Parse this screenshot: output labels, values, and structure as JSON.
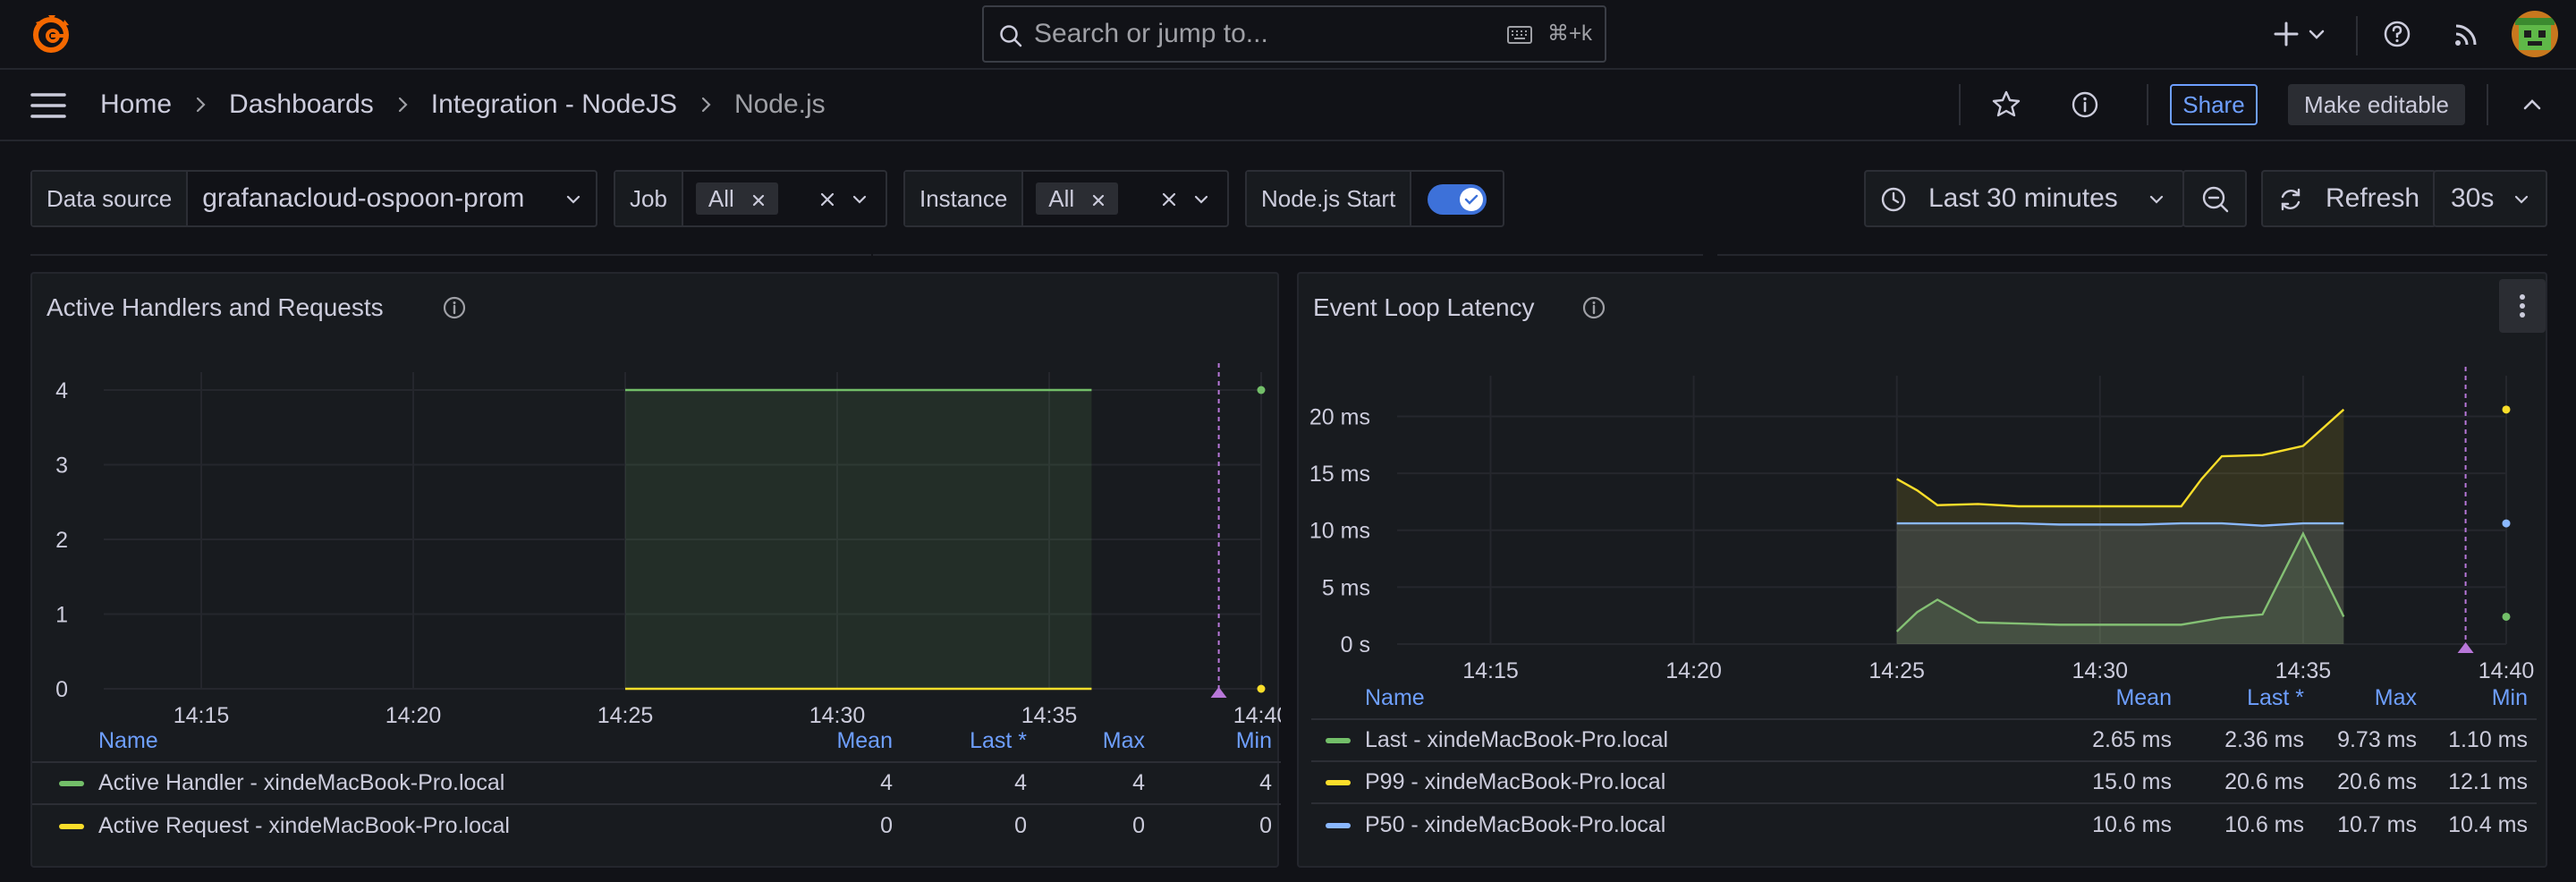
{
  "topbar": {
    "search_placeholder": "Search or jump to...",
    "search_shortcut": "⌘+k",
    "icons": [
      "grafana-logo-icon",
      "search-icon",
      "keyboard-icon",
      "plus-icon",
      "chevron-down-icon",
      "help-icon",
      "rss-icon",
      "user-avatar"
    ]
  },
  "breadcrumbs": [
    "Home",
    "Dashboards",
    "Integration - NodeJS",
    "Node.js"
  ],
  "navbar": {
    "share_label": "Share",
    "edit_label": "Make editable"
  },
  "variables": {
    "datasource": {
      "label": "Data source",
      "value": "grafanacloud-ospoon-prom"
    },
    "job": {
      "label": "Job",
      "value": "All"
    },
    "instance": {
      "label": "Instance",
      "value": "All"
    },
    "nodejs_start": {
      "label": "Node.js Start",
      "enabled": true
    }
  },
  "time": {
    "range_label": "Last 30 minutes",
    "refresh_label": "Refresh",
    "interval": "30s"
  },
  "colors": {
    "green": "#73bf69",
    "yellow": "#fade2a",
    "blue": "#8ab8ff",
    "accent": "#6e9fff",
    "purple": "#b877d9"
  },
  "panels": [
    {
      "title": "Active Handlers and Requests",
      "legend": {
        "headers": [
          "Name",
          "Mean",
          "Last *",
          "Max",
          "Min"
        ],
        "rows": [
          {
            "name": "Active Handler - xindeMacBook-Pro.local",
            "color": "#73bf69",
            "values": [
              "4",
              "4",
              "4",
              "4"
            ]
          },
          {
            "name": "Active Request - xindeMacBook-Pro.local",
            "color": "#fade2a",
            "values": [
              "0",
              "0",
              "0",
              "0"
            ]
          }
        ]
      }
    },
    {
      "title": "Event Loop Latency",
      "legend": {
        "headers": [
          "Name",
          "Mean",
          "Last *",
          "Max",
          "Min"
        ],
        "rows": [
          {
            "name": "Last - xindeMacBook-Pro.local",
            "color": "#73bf69",
            "values": [
              "2.65 ms",
              "2.36 ms",
              "9.73 ms",
              "1.10 ms"
            ]
          },
          {
            "name": "P99 - xindeMacBook-Pro.local",
            "color": "#fade2a",
            "values": [
              "15.0 ms",
              "20.6 ms",
              "20.6 ms",
              "12.1 ms"
            ]
          },
          {
            "name": "P50 - xindeMacBook-Pro.local",
            "color": "#8ab8ff",
            "values": [
              "10.6 ms",
              "10.6 ms",
              "10.7 ms",
              "10.4 ms"
            ]
          }
        ]
      }
    }
  ],
  "chart_data": [
    {
      "type": "line",
      "title": "Active Handlers and Requests",
      "x_ticks": [
        "14:15",
        "14:20",
        "14:25",
        "14:30",
        "14:35",
        "14:40"
      ],
      "y_ticks": [
        "0",
        "1",
        "2",
        "3",
        "4"
      ],
      "ylim": [
        0,
        4
      ],
      "x": [
        "14:25",
        "14:36"
      ],
      "series": [
        {
          "name": "Active Handler - xindeMacBook-Pro.local",
          "values": [
            4,
            4
          ],
          "color": "#73bf69"
        },
        {
          "name": "Active Request - xindeMacBook-Pro.local",
          "values": [
            0,
            0
          ],
          "color": "#fade2a"
        }
      ],
      "annotation": "14:39"
    },
    {
      "type": "line",
      "title": "Event Loop Latency",
      "x_ticks": [
        "14:15",
        "14:20",
        "14:25",
        "14:30",
        "14:35",
        "14:40"
      ],
      "y_ticks": [
        "0 s",
        "5 ms",
        "10 ms",
        "15 ms",
        "20 ms"
      ],
      "ylim": [
        0,
        22
      ],
      "x": [
        "14:25",
        "14:25:30",
        "14:26",
        "14:27",
        "14:28",
        "14:29",
        "14:30",
        "14:31",
        "14:32",
        "14:32:30",
        "14:33",
        "14:34",
        "14:35",
        "14:36"
      ],
      "series": [
        {
          "name": "Last - xindeMacBook-Pro.local",
          "color": "#73bf69",
          "values": [
            1.1,
            2.8,
            3.9,
            1.9,
            1.8,
            1.7,
            1.7,
            1.7,
            1.7,
            2.0,
            2.3,
            2.6,
            9.7,
            2.4
          ]
        },
        {
          "name": "P99 - xindeMacBook-Pro.local",
          "color": "#fade2a",
          "values": [
            14.5,
            13.5,
            12.2,
            12.3,
            12.1,
            12.1,
            12.1,
            12.1,
            12.1,
            14.5,
            16.5,
            16.6,
            17.4,
            20.6
          ]
        },
        {
          "name": "P50 - xindeMacBook-Pro.local",
          "color": "#8ab8ff",
          "values": [
            10.6,
            10.6,
            10.6,
            10.6,
            10.6,
            10.5,
            10.5,
            10.5,
            10.6,
            10.6,
            10.6,
            10.4,
            10.6,
            10.6
          ]
        }
      ],
      "annotation": "14:39"
    }
  ]
}
